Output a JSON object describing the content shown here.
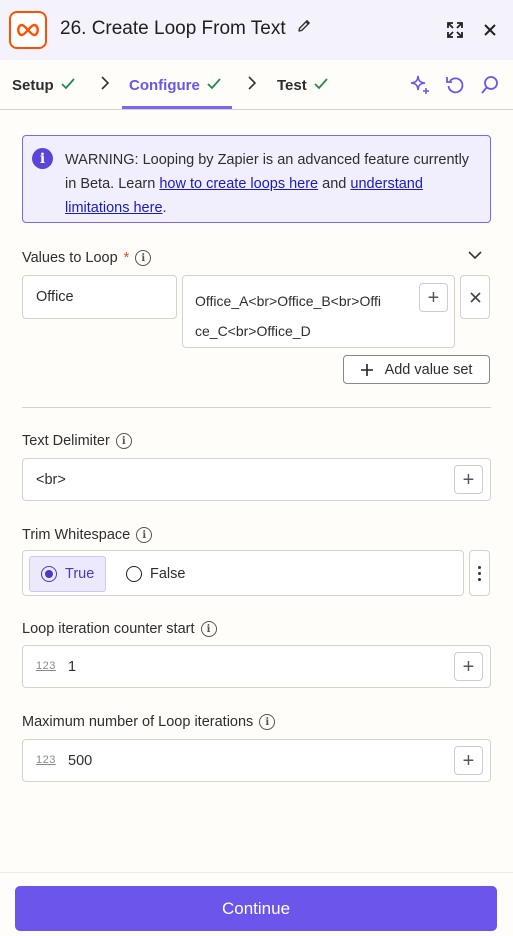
{
  "header": {
    "title": "26. Create Loop From Text"
  },
  "tabs": [
    {
      "label": "Setup",
      "status": "complete"
    },
    {
      "label": "Configure",
      "status": "complete",
      "active": true
    },
    {
      "label": "Test",
      "status": "complete"
    }
  ],
  "warning": {
    "text_before": "WARNING: Looping by Zapier is an advanced feature currently in Beta. Learn ",
    "link1": "how to create loops here",
    "text_middle": " and ",
    "link2": "understand limitations here",
    "text_after": "."
  },
  "values_to_loop": {
    "label": "Values to Loop",
    "required_mark": "*",
    "key": "Office",
    "value_line1": "Office_A<br>Office_B<br>Offi",
    "value_line2": "ce_C<br>Office_D",
    "add_value_set_label": "Add value set"
  },
  "text_delimiter": {
    "label": "Text Delimiter",
    "value": "<br>"
  },
  "trim_whitespace": {
    "label": "Trim Whitespace",
    "options": [
      "True",
      "False"
    ],
    "selected": "True"
  },
  "loop_counter_start": {
    "label": "Loop iteration counter start",
    "type_tag": "123",
    "value": "1"
  },
  "max_iterations": {
    "label": "Maximum number of Loop iterations",
    "type_tag": "123",
    "value": "500"
  },
  "footer": {
    "continue_label": "Continue"
  },
  "colors": {
    "accent": "#6c55eb",
    "success": "#1f8a4c",
    "brand": "#ff4f00"
  }
}
